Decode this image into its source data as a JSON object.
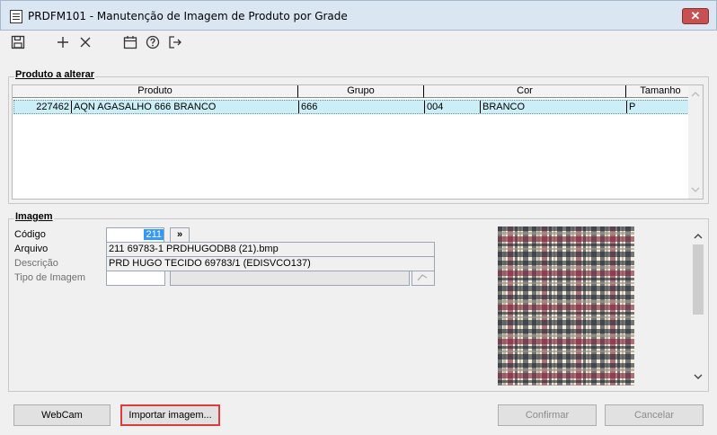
{
  "window": {
    "title": "PRDFM101 - Manutenção de Imagem de Produto por Grade",
    "close_glyph": "✕"
  },
  "toolbar": {
    "items": [
      {
        "icon": "save-icon",
        "glyph": "🖫"
      },
      {
        "icon": "add-icon",
        "glyph": "+"
      },
      {
        "icon": "delete-icon",
        "glyph": "✕"
      },
      {
        "icon": "calendar-icon",
        "glyph": "📅"
      },
      {
        "icon": "help-icon",
        "glyph": "?"
      },
      {
        "icon": "exit-icon",
        "glyph": "↦"
      }
    ]
  },
  "produto": {
    "title": "Produto a alterar",
    "columns": [
      "Produto",
      "Grupo",
      "Cor",
      "Tamanho"
    ],
    "rows": [
      {
        "codigo": "227462",
        "descricao": "AQN AGASALHO 666 BRANCO",
        "grupo": "666",
        "cor_codigo": "004",
        "cor_nome": "BRANCO",
        "tamanho": "P"
      }
    ]
  },
  "imagem": {
    "title": "Imagem",
    "codigo_label": "Código",
    "codigo_value": "211",
    "codigo_button": "»",
    "arquivo_label": "Arquivo",
    "arquivo_value": "211 69783-1 PRDHUGODB8 (21).bmp",
    "descricao_label": "Descrição",
    "descricao_value": "PRD HUGO TECIDO 69783/1 (EDISVCO137)",
    "tipo_label": "Tipo de Imagem",
    "tipo_value": "",
    "tipo_desc": "",
    "preview_colors": {
      "bg": "#f3ecd6",
      "dark": "#202634",
      "red": "#7c1d38",
      "grey": "#9b9486"
    }
  },
  "buttons": {
    "webcam": "WebCam",
    "importar": "Importar imagem...",
    "confirmar": "Confirmar",
    "cancelar": "Cancelar"
  }
}
